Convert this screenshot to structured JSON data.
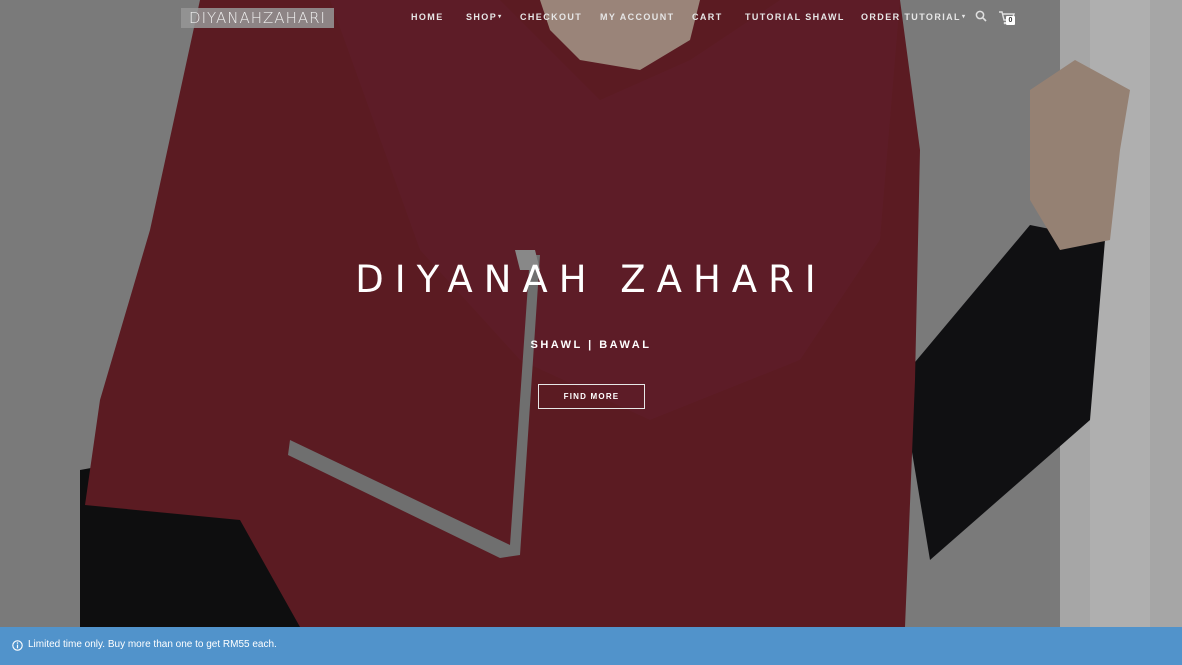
{
  "site": {
    "logo_text": "DIYANAHZAHARI"
  },
  "nav": {
    "items": [
      {
        "label": "HOME"
      },
      {
        "label": "SHOP",
        "has_dropdown": true
      },
      {
        "label": "CHECKOUT"
      },
      {
        "label": "MY ACCOUNT"
      },
      {
        "label": "CART"
      },
      {
        "label": "TUTORIAL SHAWL"
      },
      {
        "label": "ORDER TUTORIAL",
        "has_dropdown": true
      }
    ],
    "dropdown_caret": "▾",
    "search_icon": "search-icon",
    "cart_icon": "cart-icon",
    "cart_count": "0"
  },
  "hero": {
    "title": "DIYANAH ZAHARI",
    "subtitle": "SHAWL | BAWAL",
    "cta_label": "FIND MORE",
    "image": "model in maroon hijab with beaded trim"
  },
  "notice": {
    "icon": "info-icon",
    "text": "Limited time only. Buy more than one to get RM55 each."
  },
  "colors": {
    "hijab": "#7e2630",
    "notice_bar": "#5193cb",
    "text": "#ffffff"
  }
}
